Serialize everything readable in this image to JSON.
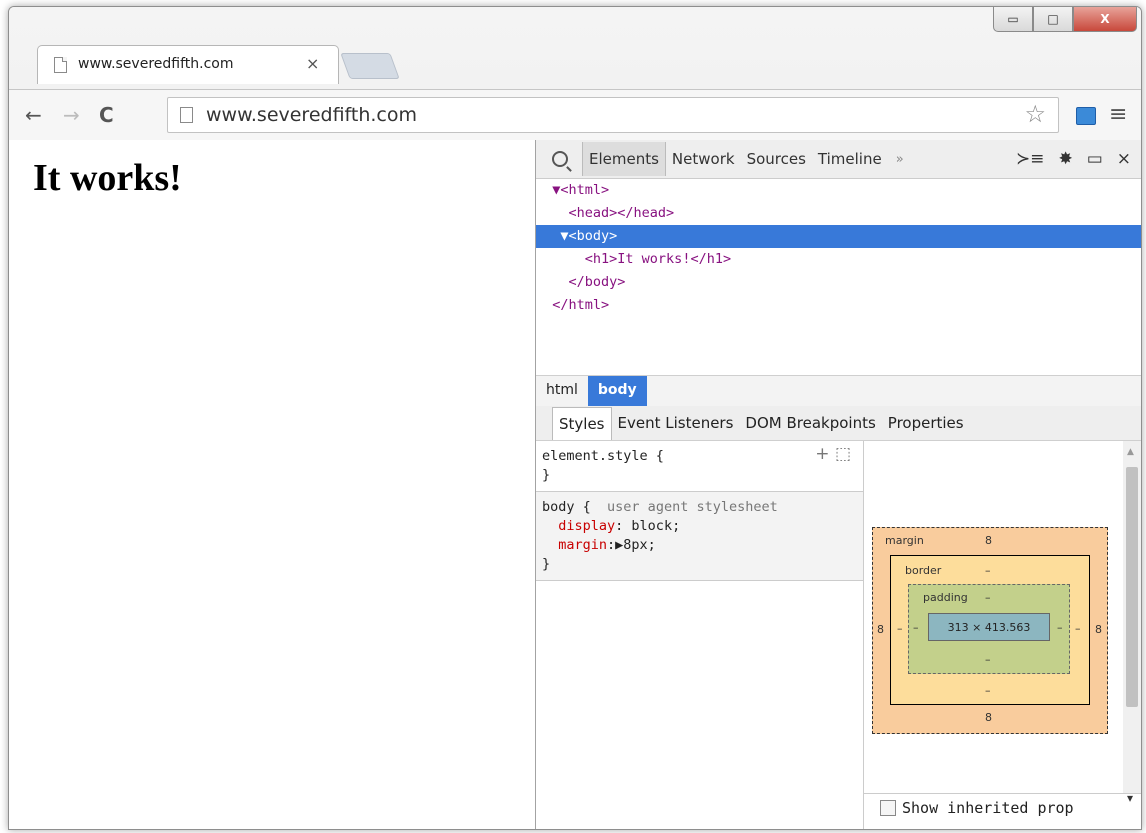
{
  "tab": {
    "title": "www.severedfifth.com",
    "close": "×"
  },
  "window_controls": {
    "minimize": "▭",
    "maximize": "□",
    "close": "X"
  },
  "toolbar": {
    "back": "←",
    "forward": "→",
    "reload": "C",
    "url": "www.severedfifth.com",
    "star": "☆",
    "menu": "≡"
  },
  "page": {
    "heading": "It works!"
  },
  "devtools": {
    "tabs": [
      "Elements",
      "Network",
      "Sources",
      "Timeline"
    ],
    "more": "»",
    "right_icons": {
      "console": "≻≡",
      "settings": "✸",
      "dock": "▭",
      "close": "×"
    },
    "dom": [
      {
        "text": "▼<html>",
        "indent": "  "
      },
      {
        "text": "<head></head>",
        "indent": "    "
      },
      {
        "text": "▼<body>",
        "indent": "   ",
        "selected": true
      },
      {
        "text": "<h1>It works!</h1>",
        "indent": "      "
      },
      {
        "text": "</body>",
        "indent": "    "
      },
      {
        "text": "</html>",
        "indent": "  "
      }
    ],
    "breadcrumbs": [
      "html",
      "body"
    ],
    "subtabs": [
      "Styles",
      "Event Listeners",
      "DOM Breakpoints",
      "Properties"
    ],
    "styles": {
      "element_style_open": "element.style {",
      "element_style_close": "}",
      "add_icon": "+",
      "toggle_icon": "⬚",
      "body_selector": "body {",
      "ua_source": "user agent stylesheet",
      "prop1_name": "display",
      "prop1_value": ": block;",
      "prop2_name": "margin",
      "prop2_value": ":▶8px;",
      "body_close": "}"
    },
    "metrics": {
      "margin_label": "margin",
      "margin_top": "8",
      "margin_bottom": "8",
      "margin_left": "8",
      "margin_right": "8",
      "border_label": "border",
      "border_top": "–",
      "border_bottom": "–",
      "border_left": "–",
      "border_right": "–",
      "padding_label": "padding",
      "padding_top": "–",
      "padding_bottom": "–",
      "padding_left": "–",
      "padding_right": "–",
      "content": "313 × 413.563"
    },
    "show_inherited": "Show inherited prop"
  }
}
